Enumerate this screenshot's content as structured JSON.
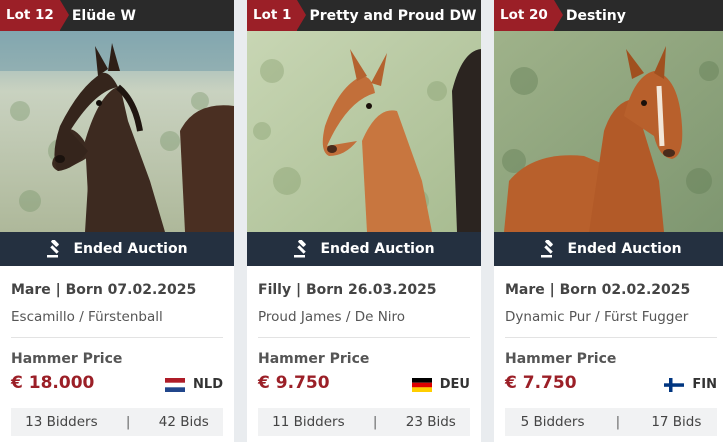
{
  "lots": [
    {
      "lot_label": "Lot 12",
      "name": "Elüde W",
      "status": "Ended Auction",
      "born": "Mare | Born 07.02.2025",
      "pedigree": "Escamillo / Fürstenball",
      "hammer_label": "Hammer Price",
      "price": "€ 18.000",
      "country_code": "NLD",
      "bidders": "13 Bidders",
      "bids": "42 Bids",
      "photo_desc_icon": "horse-photo",
      "coat_color": "#3d2a20"
    },
    {
      "lot_label": "Lot 1",
      "name": "Pretty and Proud DW",
      "status": "Ended Auction",
      "born": "Filly | Born 26.03.2025",
      "pedigree": "Proud James / De Niro",
      "hammer_label": "Hammer Price",
      "price": "€ 9.750",
      "country_code": "DEU",
      "bidders": "11 Bidders",
      "bids": "23 Bids",
      "photo_desc_icon": "horse-photo",
      "coat_color": "#c8763f"
    },
    {
      "lot_label": "Lot 20",
      "name": "Destiny",
      "status": "Ended Auction",
      "born": "Mare | Born 02.02.2025",
      "pedigree": "Dynamic Pur / Fürst Fugger",
      "hammer_label": "Hammer Price",
      "price": "€ 7.750",
      "country_code": "FIN",
      "bidders": "5 Bidders",
      "bids": "17 Bids",
      "photo_desc_icon": "horse-photo",
      "coat_color": "#b8602c"
    }
  ],
  "separator": "|",
  "colors": {
    "accent": "#9b1f27",
    "status_bar": "#243040",
    "header_bar": "#2a2a2a"
  }
}
